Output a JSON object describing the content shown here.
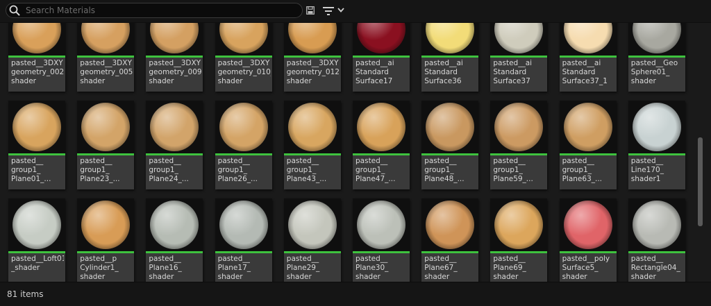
{
  "search": {
    "placeholder": "Search Materials",
    "value": ""
  },
  "toolbar": {
    "save_icon": "save-icon",
    "filter_icon": "filter-icon",
    "dropdown_icon": "chevron-down-icon"
  },
  "status": {
    "item_count": "81 items"
  },
  "colors": {
    "accent_bar": "#3ec23e",
    "background": "#1a1a1a",
    "tile": "#3a3a3a"
  },
  "materials": [
    {
      "label": "pasted__3DXY\ngeometry_002_\nshader",
      "color": "#d9a05a"
    },
    {
      "label": "pasted__3DXY\ngeometry_005_\nshader",
      "color": "#d6a060"
    },
    {
      "label": "pasted__3DXY\ngeometry_009_\nshader",
      "color": "#d4a062"
    },
    {
      "label": "pasted__3DXY\ngeometry_010_\nshader",
      "color": "#d8a35e"
    },
    {
      "label": "pasted__3DXY\ngeometry_012_\nshader",
      "color": "#d89c52"
    },
    {
      "label": "pasted__ai\nStandard\nSurface17",
      "color": "#8a1020"
    },
    {
      "label": "pasted__ai\nStandard\nSurface36",
      "color": "#f2dc78"
    },
    {
      "label": "pasted__ai\nStandard\nSurface37",
      "color": "#cfccbc"
    },
    {
      "label": "pasted__ai\nStandard\nSurface37_1",
      "color": "#f6dcb0"
    },
    {
      "label": "pasted__Geo\nSphere01_\nshader",
      "color": "#a8a8a0"
    },
    {
      "label": "pasted__\ngroup1_\nPlane01_...",
      "color": "#d8a45e"
    },
    {
      "label": "pasted__\ngroup1_\nPlane23_...",
      "color": "#d3a468"
    },
    {
      "label": "pasted__\ngroup1_\nPlane24_...",
      "color": "#d2a46a"
    },
    {
      "label": "pasted__\ngroup1_\nPlane26_...",
      "color": "#d4a466"
    },
    {
      "label": "pasted__\ngroup1_\nPlane43_...",
      "color": "#d8a660"
    },
    {
      "label": "pasted__\ngroup1_\nPlane47_...",
      "color": "#d8a25a"
    },
    {
      "label": "pasted__\ngroup1_\nPlane48_...",
      "color": "#c99860"
    },
    {
      "label": "pasted__\ngroup1_\nPlane59_...",
      "color": "#cc9a62"
    },
    {
      "label": "pasted__\ngroup1_\nPlane63_...",
      "color": "#cf9e62"
    },
    {
      "label": "pasted__\nLine170_\nshader1",
      "color": "#c8d2d2"
    },
    {
      "label": "pasted__Loft01\n_shader",
      "color": "#c6ccc4"
    },
    {
      "label": "pasted__p\nCylinder1_\nshader",
      "color": "#d89c56"
    },
    {
      "label": "pasted__\nPlane16_\nshader",
      "color": "#b6bcb4"
    },
    {
      "label": "pasted__\nPlane17_\nshader",
      "color": "#b4bab4"
    },
    {
      "label": "pasted__\nPlane29_\nshader",
      "color": "#c4c6bc"
    },
    {
      "label": "pasted__\nPlane30_\nshader",
      "color": "#bcc0b8"
    },
    {
      "label": "pasted__\nPlane67_\nshader",
      "color": "#cf9458"
    },
    {
      "label": "pasted__\nPlane69_\nshader",
      "color": "#dca65c"
    },
    {
      "label": "pasted__poly\nSurface5_\nshader",
      "color": "#e06468"
    },
    {
      "label": "pasted__\nRectangle04_\nshader",
      "color": "#b8bab4"
    }
  ]
}
